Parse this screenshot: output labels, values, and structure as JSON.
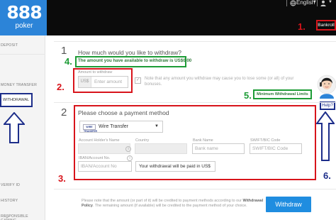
{
  "header": {
    "logo_number": "888",
    "logo_sub": "poker",
    "language": "English",
    "bankroll_label": "Bankroll"
  },
  "annotations": {
    "n1": "1.",
    "n2": "2.",
    "n3": "3.",
    "n4": "4.",
    "n5": "5.",
    "n6": "6."
  },
  "sidebar": {
    "deposit": "DEPOSIT",
    "withdrawal": "WITHDRAWAL",
    "money_transfer": "MONEY TRANSFER",
    "verify_id": "VERIFY ID",
    "history": "HISTORY",
    "responsible_gaming": "RESPONSIBLE GAMING"
  },
  "step1": {
    "number": "1",
    "title": "How much would you like to withdraw?",
    "available": "The amount you have available to withdraw is US$0.00",
    "amount_label": "Amount to withdraw",
    "currency": "US$",
    "amount_placeholder": "Enter amount",
    "note": "Note that any amount you withdraw may cause you to lose some (or all) of your bonuses.",
    "min_limits": "Minimum Withdrawal Limits"
  },
  "support": {
    "help_label": "Help?"
  },
  "step2": {
    "number": "2",
    "title": "Please choose a payment method",
    "wire_logo": "WIRE TRANSFER",
    "method_selected": "Wire Transfer",
    "account_holder_label": "Account Holder's Name",
    "country_label": "Country",
    "bank_name_label": "Bank Name",
    "bank_name_placeholder": "Bank name",
    "swift_label": "SWIFT/BIC Code",
    "swift_placeholder": "SWIFT/BIC Code",
    "iban_label": "IBAN/Account No.",
    "iban_placeholder": "IBAN/Account No",
    "paid_in": "Your withdrawal will be paid in US$"
  },
  "footer": {
    "note_part1": "Please note that the amount (or part of it) will be credited to payment methods according to our ",
    "policy_link": "Withdrawal Policy",
    "note_part2": ". The remaining amount (if available) will be credited to the payment method of your choice.",
    "withdraw_button": "Withdraw"
  },
  "colors": {
    "brand_blue": "#2c84d8",
    "annotation_red": "#d8141b",
    "annotation_green": "#1d9c36",
    "annotation_navy": "#1d2e8a",
    "button_blue": "#1f8de0"
  }
}
